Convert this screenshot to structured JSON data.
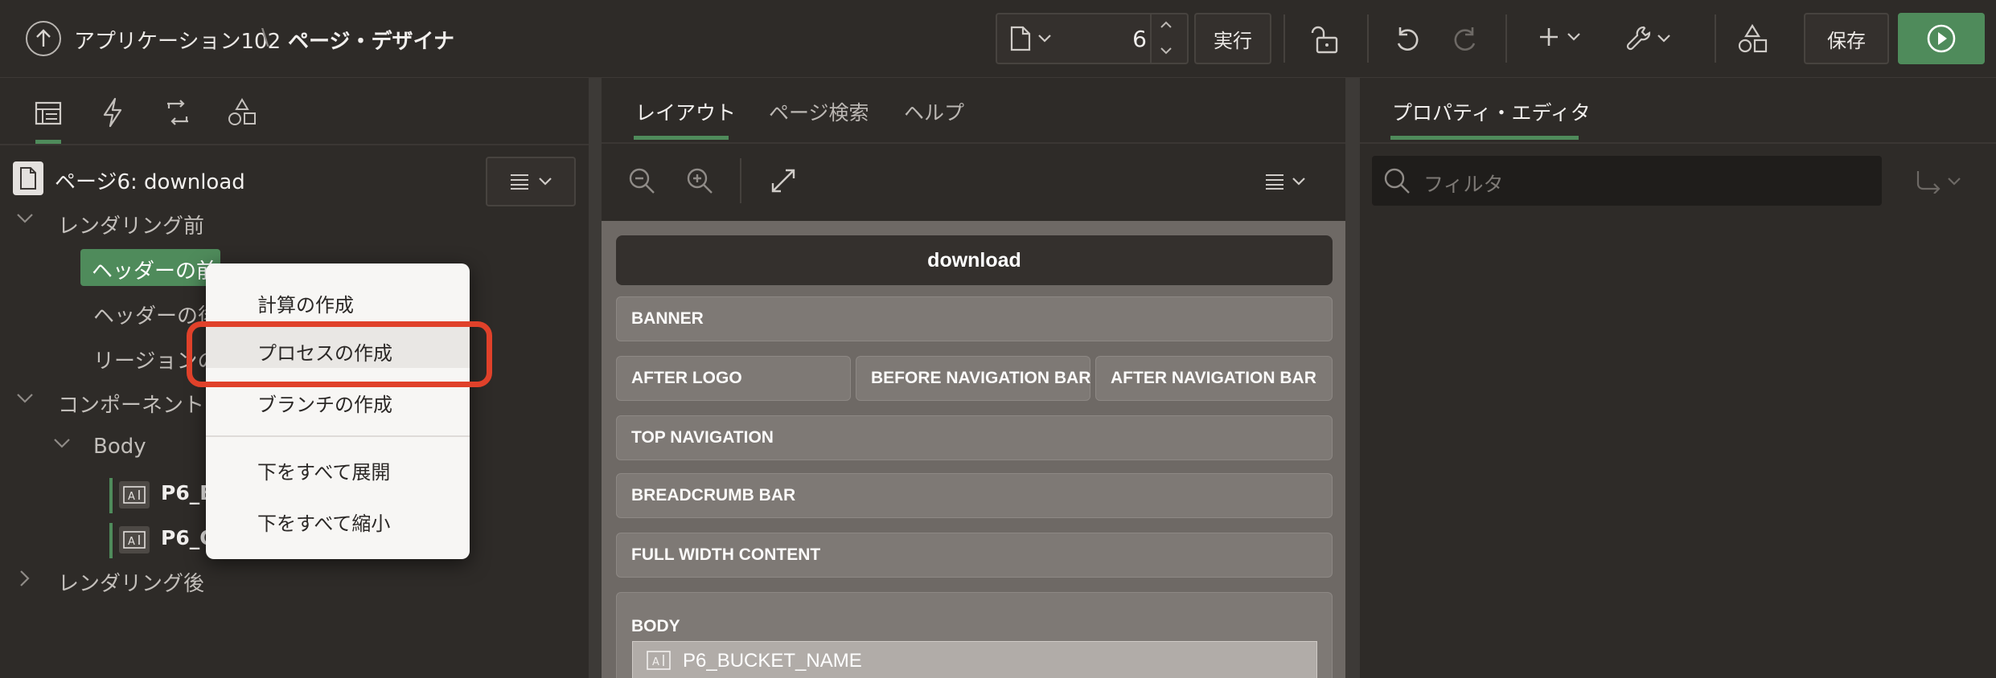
{
  "header": {
    "app_name": "アプリケーション102",
    "separator": "\\",
    "page_designer": "ページ・デザイナ",
    "page_number": "6",
    "run_label": "実行",
    "save_label": "保存"
  },
  "left_panel": {
    "page_title": "ページ6: download",
    "tree": {
      "before_rendering": "レンダリング前",
      "before_header": "ヘッダーの前",
      "after_header": "ヘッダーの後",
      "regions_partial": "リージョンの",
      "components": "コンポーネント",
      "body": "Body",
      "item1_partial": "P6_B",
      "item2_partial": "P6_O",
      "after_rendering": "レンダリング後"
    }
  },
  "context_menu": {
    "items": [
      "計算の作成",
      "プロセスの作成",
      "ブランチの作成",
      "下をすべて展開",
      "下をすべて縮小"
    ],
    "highlighted": "プロセスの作成"
  },
  "center_panel": {
    "tabs": [
      "レイアウト",
      "ページ検索",
      "ヘルプ"
    ],
    "active_tab": "レイアウト",
    "page_header": "download",
    "regions": {
      "banner": "BANNER",
      "after_logo": "AFTER LOGO",
      "before_nav": "BEFORE NAVIGATION BAR",
      "after_nav": "AFTER NAVIGATION BAR",
      "top_nav": "TOP NAVIGATION",
      "breadcrumb": "BREADCRUMB BAR",
      "full_width": "FULL WIDTH CONTENT",
      "body": "BODY",
      "bucket_item": "P6_BUCKET_NAME"
    }
  },
  "right_panel": {
    "title": "プロパティ・エディタ",
    "filter_placeholder": "フィルタ"
  },
  "colors": {
    "accent_green": "#4f8b5b",
    "highlight_red": "#e0412a",
    "canvas_bg": "#7e7975",
    "menu_bg": "#f7f6f4"
  }
}
